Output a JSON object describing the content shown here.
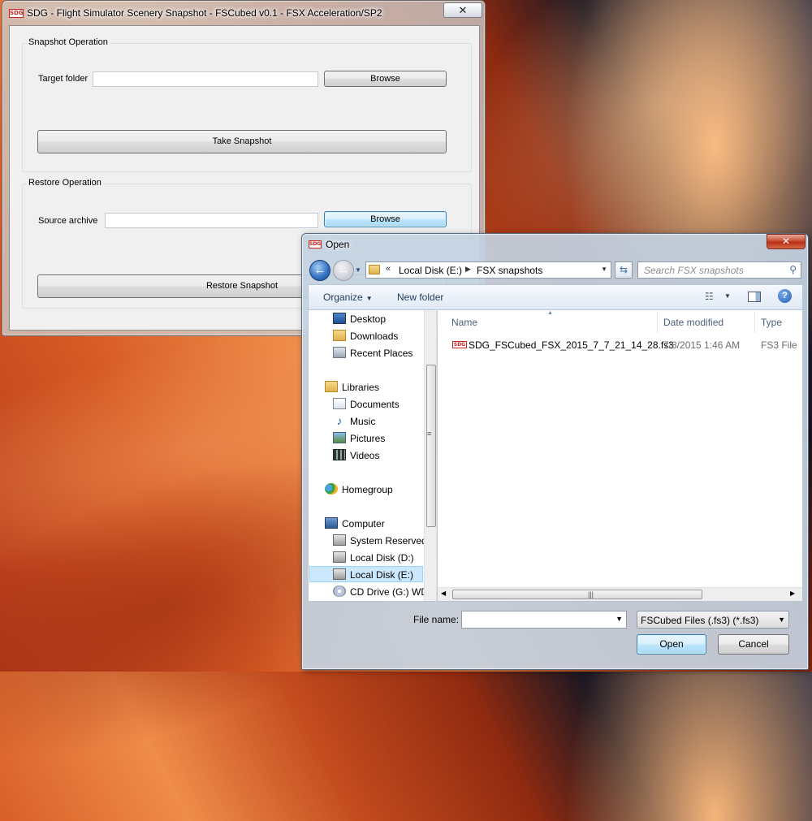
{
  "sdg_window": {
    "title": "SDG - Flight Simulator Scenery Snapshot - FSCubed v0.1 - FSX Acceleration/SP2",
    "close_glyph": "✕",
    "snapshot_group": {
      "title": "Snapshot Operation",
      "target_label": "Target folder",
      "target_value": "",
      "browse_label": "Browse",
      "action_label": "Take Snapshot"
    },
    "restore_group": {
      "title": "Restore Operation",
      "source_label": "Source archive",
      "source_value": "",
      "browse_label": "Browse",
      "action_label": "Restore Snapshot"
    }
  },
  "open_dialog": {
    "title": "Open",
    "close_glyph": "✕",
    "address": {
      "overflow": "«",
      "parts": [
        "Local Disk (E:)",
        "FSX snapshots"
      ]
    },
    "search_placeholder": "Search FSX snapshots",
    "toolbar": {
      "organize_label": "Organize",
      "new_folder_label": "New folder"
    },
    "nav_items": [
      {
        "label": "Desktop",
        "icon": "desktop-icon"
      },
      {
        "label": "Downloads",
        "icon": "downloads-folder-icon"
      },
      {
        "label": "Recent Places",
        "icon": "recent-places-icon"
      },
      {
        "label": "Libraries",
        "icon": "libraries-icon"
      },
      {
        "label": "Documents",
        "icon": "documents-icon"
      },
      {
        "label": "Music",
        "icon": "music-icon"
      },
      {
        "label": "Pictures",
        "icon": "pictures-icon"
      },
      {
        "label": "Videos",
        "icon": "videos-icon"
      },
      {
        "label": "Homegroup",
        "icon": "homegroup-icon"
      },
      {
        "label": "Computer",
        "icon": "computer-icon"
      },
      {
        "label": "System Reserved",
        "icon": "drive-icon"
      },
      {
        "label": "Local Disk (D:)",
        "icon": "drive-icon"
      },
      {
        "label": "Local Disk (E:)",
        "icon": "drive-icon",
        "selected": true
      },
      {
        "label": "CD Drive (G:) WD",
        "icon": "cd-drive-icon"
      }
    ],
    "columns": [
      "Name",
      "Date modified",
      "Type"
    ],
    "files": [
      {
        "name": "SDG_FSCubed_FSX_2015_7_7_21_14_28.fs3",
        "date_modified": "7/8/2015 1:46 AM",
        "type": "FS3 File",
        "icon_text": "SDG"
      }
    ],
    "file_name_label": "File name:",
    "file_name_value": "",
    "file_type_value": "FSCubed Files (.fs3) (*.fs3)",
    "open_label": "Open",
    "cancel_label": "Cancel"
  },
  "app_icon_text": "SDG"
}
